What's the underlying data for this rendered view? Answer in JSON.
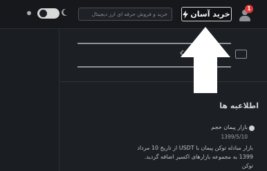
{
  "header": {
    "notification_count": "1",
    "quick_buy_label": "خرید آسان",
    "search_placeholder": "خرید و فروش حرفه ای ارز دیجیتال"
  },
  "news": {
    "title": "اطلاعیه ها",
    "item": {
      "heading": "بازار پیمان حجم",
      "date": "1399/5/10",
      "body": "بازار مبادله توکن پیمان با USDT از تاریخ 10 مرداد 1399 به مجموعه بازارهای اکسیر اضافه گردید. توکن"
    }
  },
  "colors": {
    "accent": "#e23838",
    "background": "#1c1f24",
    "arrow": "#ffffff"
  },
  "icons": {
    "user": "user-icon",
    "bolt": "bolt-icon",
    "moon": "moon-icon",
    "chat": "chat-icon",
    "arrow": "arrow-up-icon"
  }
}
